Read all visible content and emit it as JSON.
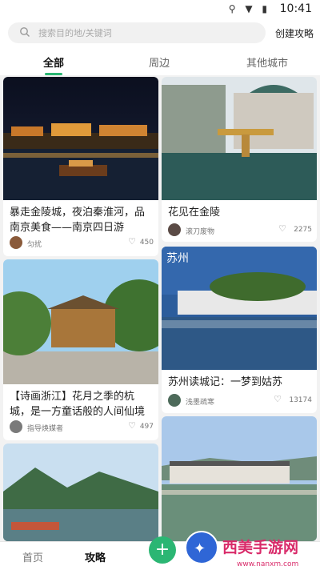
{
  "status": {
    "time": "10:41"
  },
  "search": {
    "placeholder": "搜索目的地/关键词"
  },
  "header": {
    "create": "创建攻略"
  },
  "tabs": [
    "全部",
    "周边",
    "其他城市"
  ],
  "cards": [
    {
      "title": "暴走金陵城，夜泊秦淮河，品南京美食——南京四日游",
      "author": "匀扰",
      "likes": "450"
    },
    {
      "title": "花见在金陵",
      "author": "滚刀废物",
      "likes": "2275"
    },
    {
      "title": "【诗画浙江】花月之季的杭城，是一方童话般的人间仙境",
      "author": "指导焕媒者",
      "likes": "497"
    },
    {
      "title": "苏州读城记：一梦到姑苏",
      "author": "浅墨疏寒",
      "likes": "13174",
      "overlay": "苏州"
    }
  ],
  "bottom_nav": [
    "首页",
    "攻略"
  ],
  "watermark": {
    "brand": "西美手游网",
    "url": "www.nanxm.com"
  }
}
